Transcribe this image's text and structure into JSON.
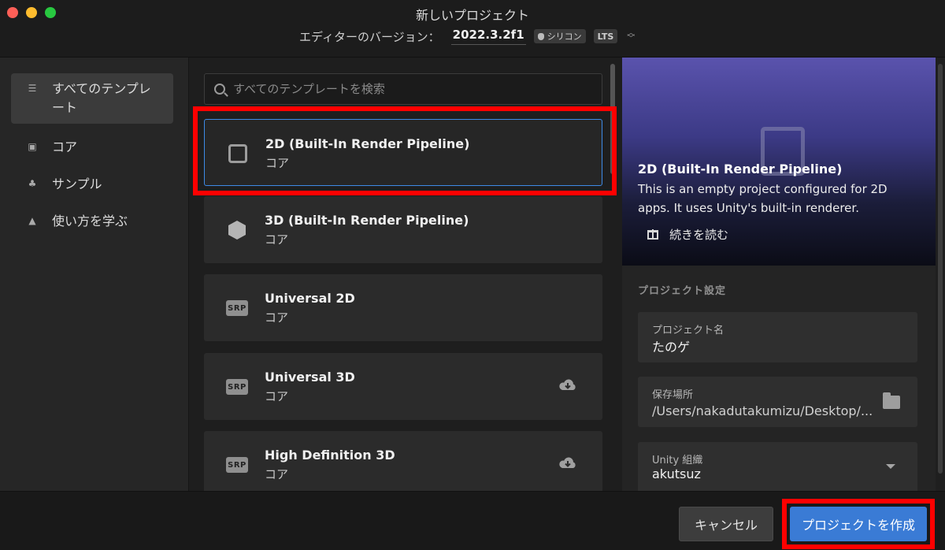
{
  "window": {
    "title": "新しいプロジェクト",
    "version_label": "エディターのバージョン：",
    "version_value": "2022.3.2f1",
    "badge_silicon": "シリコン",
    "badge_lts": "LTS"
  },
  "sidebar": {
    "items": [
      {
        "label": "すべてのテンプレート",
        "icon": "list-icon",
        "active": true
      },
      {
        "label": "コア",
        "icon": "square-icon"
      },
      {
        "label": "サンプル",
        "icon": "shapes-icon"
      },
      {
        "label": "使い方を学ぶ",
        "icon": "graduation-cap-icon"
      }
    ]
  },
  "search": {
    "placeholder": "すべてのテンプレートを検索"
  },
  "templates": [
    {
      "title": "2D (Built-In Render Pipeline)",
      "category": "コア",
      "icon": "2d-square-icon",
      "selected": true
    },
    {
      "title": "3D (Built-In Render Pipeline)",
      "category": "コア",
      "icon": "3d-cube-icon"
    },
    {
      "title": "Universal 2D",
      "category": "コア",
      "icon": "srp-icon",
      "icon_text": "SRP"
    },
    {
      "title": "Universal 3D",
      "category": "コア",
      "icon": "srp-icon",
      "icon_text": "SRP",
      "download": true
    },
    {
      "title": "High Definition 3D",
      "category": "コア",
      "icon": "srp-icon",
      "icon_text": "SRP",
      "download": true
    }
  ],
  "preview": {
    "title": "2D (Built-In Render Pipeline)",
    "description": "This is an empty project configured for 2D apps. It uses Unity's built-in renderer.",
    "read_more": "続きを読む"
  },
  "settings": {
    "heading": "プロジェクト設定",
    "project_name_label": "プロジェクト名",
    "project_name_value": "たのゲ",
    "location_label": "保存場所",
    "location_value": "/Users/nakadutakumizu/Desktop/...",
    "org_label": "Unity 組織",
    "org_value": "akutsuz"
  },
  "footer": {
    "cancel_label": "キャンセル",
    "create_label": "プロジェクトを作成"
  },
  "colors": {
    "accent": "#3a7bd5",
    "highlight": "#ff0000",
    "selection_border": "#3d8ae6"
  }
}
